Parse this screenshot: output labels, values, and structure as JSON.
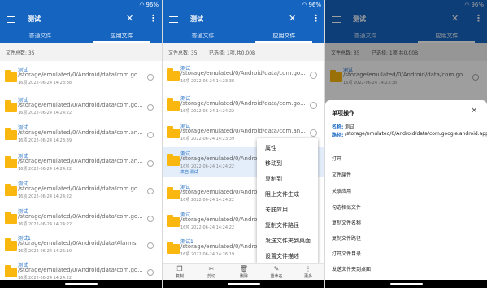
{
  "status": {
    "battery": "96%"
  },
  "appbar": {
    "search_text": "测试",
    "close_glyph": "✕",
    "more_glyph": "⋮"
  },
  "tabs": [
    {
      "label": "普通文件"
    },
    {
      "label": "应用文件"
    }
  ],
  "count_label": "文件总数: 35",
  "selected_label": "已选择: 1项,共0.00B",
  "list_left": [
    {
      "name": "测试",
      "path": "/storage/emulated/0/Android/data/com.go...",
      "meta": "16项  2022-06-24 14:23:38"
    },
    {
      "name": "测试",
      "path": "/storage/emulated/0/Android/data/com.go...",
      "meta": "16项  2022-06-24 14:24:22"
    },
    {
      "name": "测试",
      "path": "/storage/emulated/0/Android/data/com.an...",
      "meta": "16项  2022-06-24 14:23:39"
    },
    {
      "name": "测试",
      "path": "/storage/emulated/0/Android/data/com.an...",
      "meta": "16项  2022-06-24 14:24:22"
    },
    {
      "name": "测试",
      "path": "/storage/emulated/0/Android/data/com.go...",
      "meta": "16项  2022-06-24 14:24:22"
    },
    {
      "name": "测试",
      "path": "/storage/emulated/0/Android/data/com.go...",
      "meta": "16项  2022-06-24 14:24:22"
    },
    {
      "name": "测试1",
      "path": "/storage/emulated/0/Android/data/Alarms",
      "meta": "16项  2022-06-24 14:26:19"
    },
    {
      "name": "测试",
      "path": "/storage/emulated/0/Android/data/com.go...",
      "meta": "16项  2022-06-24 14:24:22"
    }
  ],
  "list_middle": [
    {
      "name": "测试",
      "path": "/storage/emulated/0/Android/data/com.go...",
      "meta": "16项  2022-06-24 14:23:38"
    },
    {
      "name": "测试",
      "path": "/storage/emulated/0/Android/data/com.go...",
      "meta": "16项  2022-06-24 14:24:22"
    },
    {
      "name": "测试",
      "path": "/storage/emulated/0/Android/data/com.an...",
      "meta": "16项  2022-06-24 14:23:39"
    },
    {
      "name": "测试",
      "path": "/storage/emulated/0/Android/data/com.an...",
      "meta": "16项  2022-06-24 14:24:22",
      "tag": "来自  测试"
    },
    {
      "name": "测试",
      "path": "/storage/emulated/0/Android/data/com.go...",
      "meta": "16项  2022-06-24 14:24:22"
    },
    {
      "name": "测试",
      "path": "/storage/emulated/0/Android/data/com.go...",
      "meta": "16项  2022-06-24 14:24:22"
    },
    {
      "name": "测试1",
      "path": "/storage/emulated/0/Android/data/Alarms",
      "meta": "16项  2022-06-24 14:26:19"
    }
  ],
  "list_right_top": {
    "name": "测试",
    "path": "/storage/emulated/0/Android/data/com.go...",
    "meta": "16项  2022-06-24 14:23:38"
  },
  "popup_menu": [
    "属性",
    "移动到",
    "复制到",
    "阻止文件生成",
    "关联应用",
    "复制文件路径",
    "发送文件夹到桌面",
    "设置文件描述"
  ],
  "bottom_bar": [
    "复制",
    "剪切",
    "删除",
    "重命名",
    "更多"
  ],
  "sheet": {
    "title": "单项操作",
    "close_glyph": "✕",
    "name_key": "名称:",
    "name_value": "测试",
    "path_key": "路径:",
    "path_value": "/storage/emulated/0/Android/data/com.google.android.apps.nbu.files/Audiobooks",
    "actions": [
      "打开",
      "文件属性",
      "关联应用",
      "勾选相似文件",
      "复制文件名称",
      "复制文件路径",
      "打开文件目录",
      "发送文件夹到桌面"
    ]
  }
}
